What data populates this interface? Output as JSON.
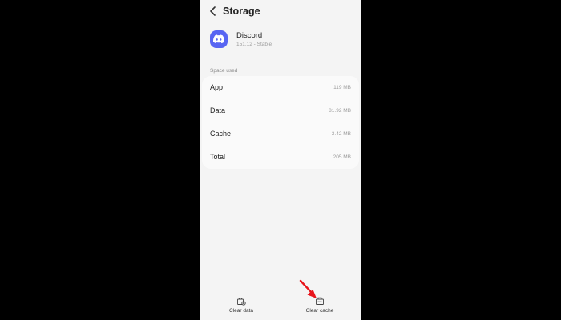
{
  "header": {
    "title": "Storage",
    "back_icon": "back-arrow-icon"
  },
  "app": {
    "name": "Discord",
    "version": "151.12 - Stable",
    "icon": "discord-icon",
    "icon_bg_color": "#5865F2"
  },
  "space_used": {
    "label": "Space used",
    "rows": [
      {
        "label": "App",
        "value": "119 MB"
      },
      {
        "label": "Data",
        "value": "81.92 MB"
      },
      {
        "label": "Cache",
        "value": "3.42 MB"
      },
      {
        "label": "Total",
        "value": "205 MB"
      }
    ]
  },
  "actions": {
    "clear_data": {
      "label": "Clear data",
      "icon": "clear-data-icon"
    },
    "clear_cache": {
      "label": "Clear cache",
      "icon": "clear-cache-icon"
    }
  },
  "annotation": {
    "arrow_color": "#e8141b"
  }
}
